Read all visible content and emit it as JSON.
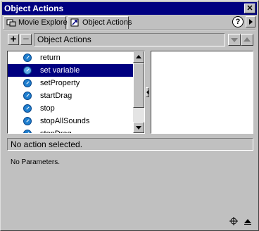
{
  "window": {
    "title": "Object Actions",
    "close_glyph": "✕"
  },
  "tabs": [
    {
      "label": "Movie Explorer",
      "icon": "movie-explorer-icon",
      "active": false
    },
    {
      "label": "Object Actions",
      "icon": "object-actions-icon",
      "active": true
    }
  ],
  "toolbar": {
    "add_label": "+",
    "remove_label": "−",
    "field_value": "Object Actions",
    "help_label": "?"
  },
  "actions_list": {
    "items": [
      {
        "label": "return",
        "icon": "action-arrow-icon",
        "selected": false
      },
      {
        "label": "set variable",
        "icon": "action-arrow-icon",
        "selected": true
      },
      {
        "label": "setProperty",
        "icon": "action-arrow-icon",
        "selected": false
      },
      {
        "label": "startDrag",
        "icon": "action-arrow-icon",
        "selected": false
      },
      {
        "label": "stop",
        "icon": "action-arrow-icon",
        "selected": false
      },
      {
        "label": "stopAllSounds",
        "icon": "action-arrow-icon",
        "selected": false
      },
      {
        "label": "stopDrag",
        "icon": "action-arrow-icon",
        "selected": false
      }
    ]
  },
  "status": {
    "text": "No action selected."
  },
  "parameters": {
    "text": "No Parameters."
  },
  "colors": {
    "title_bar": "#000080",
    "selection": "#000080",
    "panel": "#c0c0c0",
    "icon": "#1f7fcf"
  }
}
